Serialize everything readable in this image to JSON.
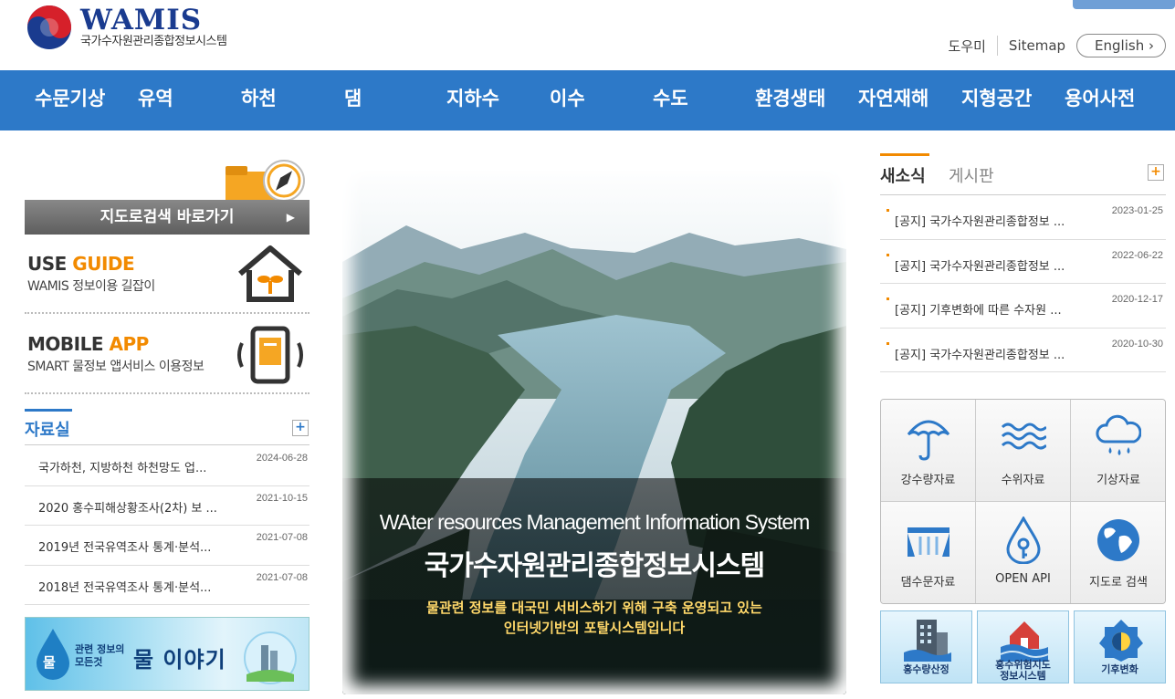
{
  "site": {
    "name": "WAMIS",
    "subtitle": "국가수자원관리종합정보시스템"
  },
  "util": {
    "help": "도우미",
    "sitemap": "Sitemap",
    "english": "English"
  },
  "nav": {
    "items": [
      "수문기상",
      "유역",
      "하천",
      "댐",
      "지하수",
      "이수",
      "수도",
      "환경생태",
      "자연재해",
      "지형공간",
      "용어사전"
    ]
  },
  "left": {
    "map_button": "지도로검색 바로가기",
    "use_guide": {
      "title_a": "USE ",
      "title_b": "GUIDE",
      "sub": "WAMIS 정보이용 길잡이"
    },
    "mobile_app": {
      "title_a": "MOBILE ",
      "title_b": "APP",
      "sub": "SMART 물정보 앱서비스 이용정보"
    },
    "library": {
      "title": "자료실",
      "items": [
        {
          "title": "국가하천, 지방하천 하천망도 업...",
          "date": "2024-06-28"
        },
        {
          "title": "2020 홍수피해상황조사(2차) 보 ...",
          "date": "2021-10-15"
        },
        {
          "title": "2019년 전국유역조사 통계·분석...",
          "date": "2021-07-08"
        },
        {
          "title": "2018년 전국유역조사 통계·분석...",
          "date": "2021-07-08"
        }
      ]
    },
    "water_banner": {
      "drop": "물",
      "sub_line1": "관련 정보의",
      "sub_line2": "모든것",
      "main": "물 이야기"
    }
  },
  "hero": {
    "title_en": "WAter resources Management Information System",
    "title_ko": "국가수자원관리종합정보시스템",
    "desc_line1": "물관련 정보를 대국민 서비스하기 위해 구축 운영되고 있는",
    "desc_line2": "인터넷기반의 포탈시스템입니다"
  },
  "right": {
    "tabs": [
      "새소식",
      "게시판"
    ],
    "news": [
      {
        "title": "[공지] 국가수자원관리종합정보 ...",
        "date": "2023-01-25"
      },
      {
        "title": "[공지] 국가수자원관리종합정보 ...",
        "date": "2022-06-22"
      },
      {
        "title": "[공지] 기후변화에 따른 수자원 ...",
        "date": "2020-12-17"
      },
      {
        "title": "[공지] 국가수자원관리종합정보 ...",
        "date": "2020-10-30"
      }
    ],
    "quick": [
      {
        "label": "강수량자료",
        "icon": "umbrella-icon"
      },
      {
        "label": "수위자료",
        "icon": "water-level-icon"
      },
      {
        "label": "기상자료",
        "icon": "rain-cloud-icon"
      },
      {
        "label": "댐수문자료",
        "icon": "dam-gate-icon"
      },
      {
        "label": "OPEN API",
        "icon": "drop-key-icon"
      },
      {
        "label": "지도로 검색",
        "icon": "globe-icon"
      }
    ],
    "bottom": [
      {
        "label": "홍수량산정",
        "icon": "building-icon"
      },
      {
        "label_line1": "홍수위험지도",
        "label_line2": "정보시스템",
        "icon": "flood-house-icon"
      },
      {
        "label": "기후변화",
        "icon": "climate-icon"
      }
    ]
  },
  "colors": {
    "nav_bg": "#2d79c8",
    "accent_orange": "#f28a00",
    "brand_navy": "#1a3b8f"
  }
}
